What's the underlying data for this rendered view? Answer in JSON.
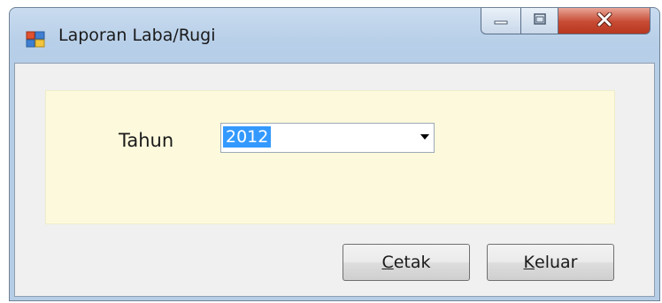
{
  "window": {
    "title": "Laporan Laba/Rugi",
    "icon": "form-window-icon",
    "controls": [
      "minimize-icon",
      "maximize-icon",
      "close-icon"
    ]
  },
  "form": {
    "tahun_label": "Tahun",
    "tahun_value": "2012"
  },
  "buttons": {
    "cetak": {
      "mnemonic": "C",
      "rest": "etak"
    },
    "keluar": {
      "mnemonic": "K",
      "rest": "eluar"
    }
  },
  "colors": {
    "panel_background": "#fcf9dc",
    "selection": "#3399ff",
    "close_button": "#c74a33"
  }
}
